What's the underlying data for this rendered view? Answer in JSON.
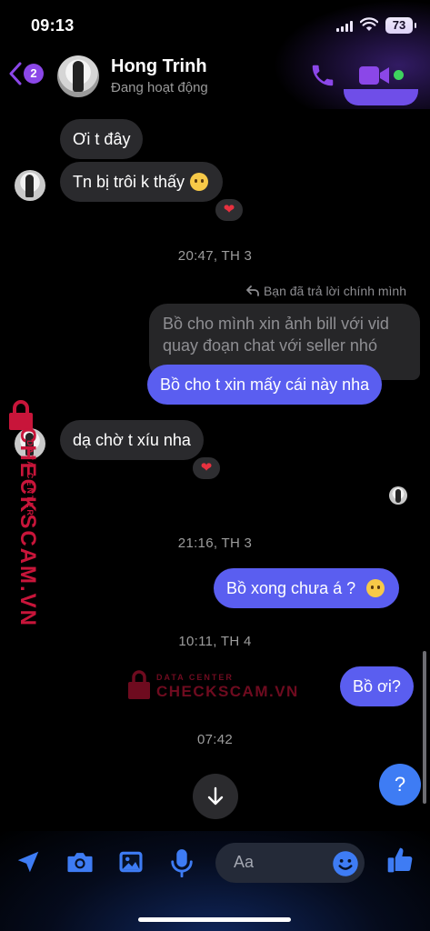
{
  "status_bar": {
    "time": "09:13",
    "battery": "73"
  },
  "header": {
    "back_badge": "2",
    "contact_name": "Hong Trinh",
    "contact_status": "Đang hoạt động",
    "accent_color": "#8b47e8"
  },
  "messages": [
    {
      "id": "m1",
      "side": "in",
      "text": "Ơi t đây"
    },
    {
      "id": "m2",
      "side": "in",
      "text": "Tn bị trôi k thấy",
      "emoji": "face-holding-back-tears",
      "reaction": "❤"
    },
    {
      "id": "t1",
      "type": "timestamp",
      "text": "20:47, TH 3"
    },
    {
      "id": "r1",
      "type": "reply_note",
      "text": "Bạn đã trả lời chính mình"
    },
    {
      "id": "m3",
      "side": "quoted",
      "text": "Bồ cho mình xin ảnh bill với vid quay đoạn chat với seller nhó"
    },
    {
      "id": "m4",
      "side": "out",
      "text": "Bồ cho t xin mấy cái này nha"
    },
    {
      "id": "m5",
      "side": "in",
      "text": "dạ chờ t xíu nha",
      "reaction": "❤"
    },
    {
      "id": "t2",
      "type": "timestamp",
      "text": "21:16, TH 3"
    },
    {
      "id": "m6",
      "side": "out",
      "text": "Bồ xong chưa á ?",
      "emoji": "pleading-face"
    },
    {
      "id": "t3",
      "type": "timestamp",
      "text": "10:11, TH 4"
    },
    {
      "id": "m7",
      "side": "out",
      "text": "Bồ ơi?"
    },
    {
      "id": "t4",
      "type": "timestamp",
      "text": "07:42"
    }
  ],
  "watermark": {
    "brand": "CHECKSCAM.VN",
    "tagline": "DATA CENTER"
  },
  "composer": {
    "placeholder": "Aa",
    "icons": [
      "send-location-icon",
      "camera-icon",
      "gallery-icon",
      "microphone-icon",
      "emoji-icon",
      "like-icon"
    ]
  },
  "floating": {
    "help_label": "?"
  }
}
